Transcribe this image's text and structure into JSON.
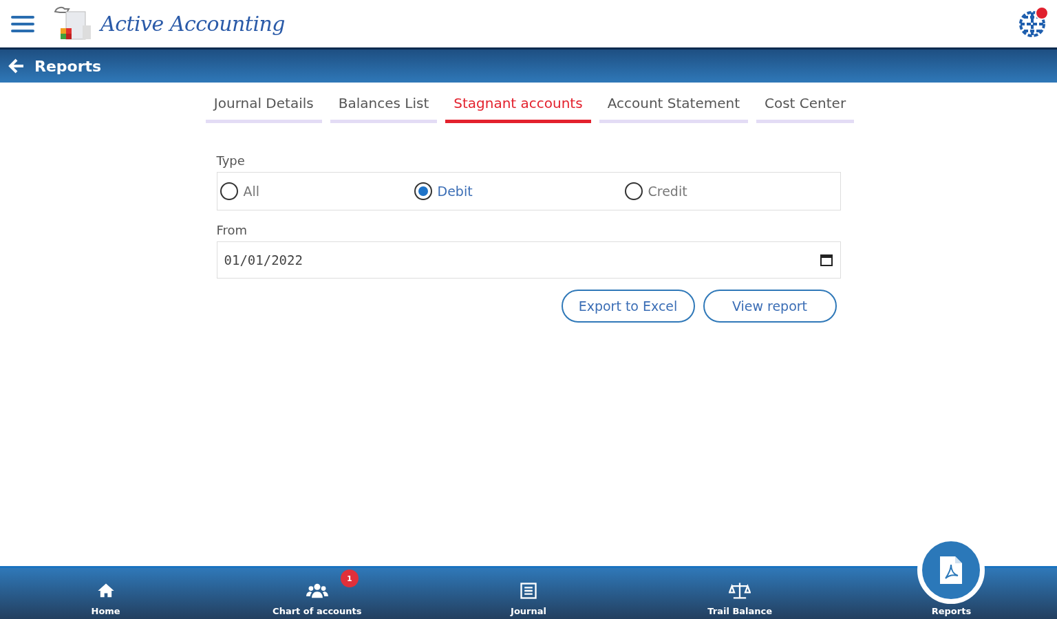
{
  "header": {
    "logo_text": "Active Accounting",
    "notification_badge": true
  },
  "title_bar": {
    "title": "Reports"
  },
  "tabs": [
    {
      "label": "Journal Details",
      "selected": false
    },
    {
      "label": "Balances List",
      "selected": false
    },
    {
      "label": "Stagnant accounts",
      "selected": true
    },
    {
      "label": "Account Statement",
      "selected": false
    },
    {
      "label": "Cost Center",
      "selected": false
    }
  ],
  "form": {
    "type_label": "Type",
    "type_options": [
      {
        "label": "All",
        "selected": false
      },
      {
        "label": "Debit",
        "selected": true
      },
      {
        "label": "Credit",
        "selected": false
      }
    ],
    "from_label": "From",
    "from_value": "01/01/2022"
  },
  "buttons": [
    "Export to Excel",
    "View report"
  ],
  "bottom_nav": [
    {
      "kind": "home",
      "label": "Home",
      "selected": false
    },
    {
      "kind": "people",
      "label": "Chart of accounts",
      "selected": false,
      "badge": "1"
    },
    {
      "kind": "journal",
      "label": "Journal",
      "selected": false
    },
    {
      "kind": "scale",
      "label": "Trail Balance",
      "selected": false
    },
    {
      "kind": "pdf",
      "label": "Reports",
      "selected": true
    }
  ]
}
